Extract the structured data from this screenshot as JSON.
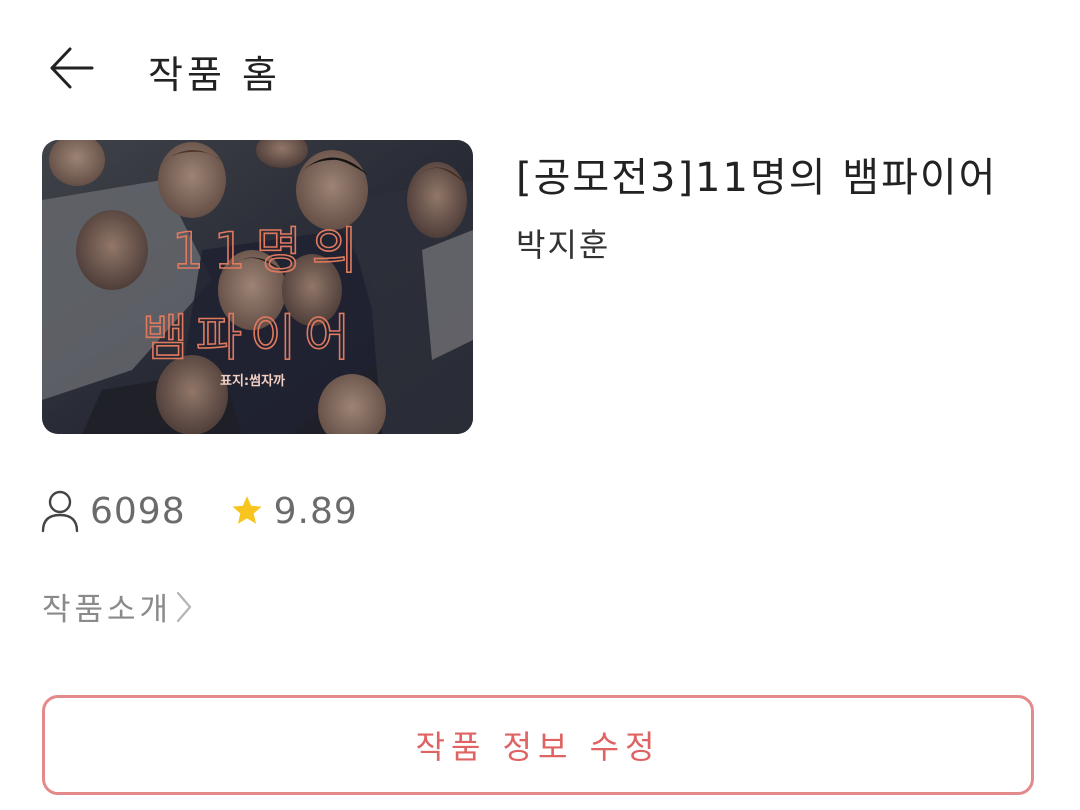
{
  "header": {
    "title": "작품 홈",
    "back_icon": "arrow-left-icon"
  },
  "work": {
    "title": "[공모전3]11명의 뱀파이어",
    "author": "박지훈",
    "cover": {
      "text_line1": "11명의",
      "text_line2": "뱀파이어",
      "credit": "표지:썸자까"
    }
  },
  "stats": {
    "views_icon": "person-icon",
    "views": "6098",
    "rating_icon": "star-icon",
    "rating": "9.89"
  },
  "intro": {
    "label": "작품소개",
    "icon": "chevron-right-icon"
  },
  "actions": {
    "edit_label": "작품 정보 수정"
  },
  "colors": {
    "accent": "#e06363",
    "accent_border": "#e58a8a",
    "star": "#f7c51e",
    "muted": "#8a8a8a"
  }
}
